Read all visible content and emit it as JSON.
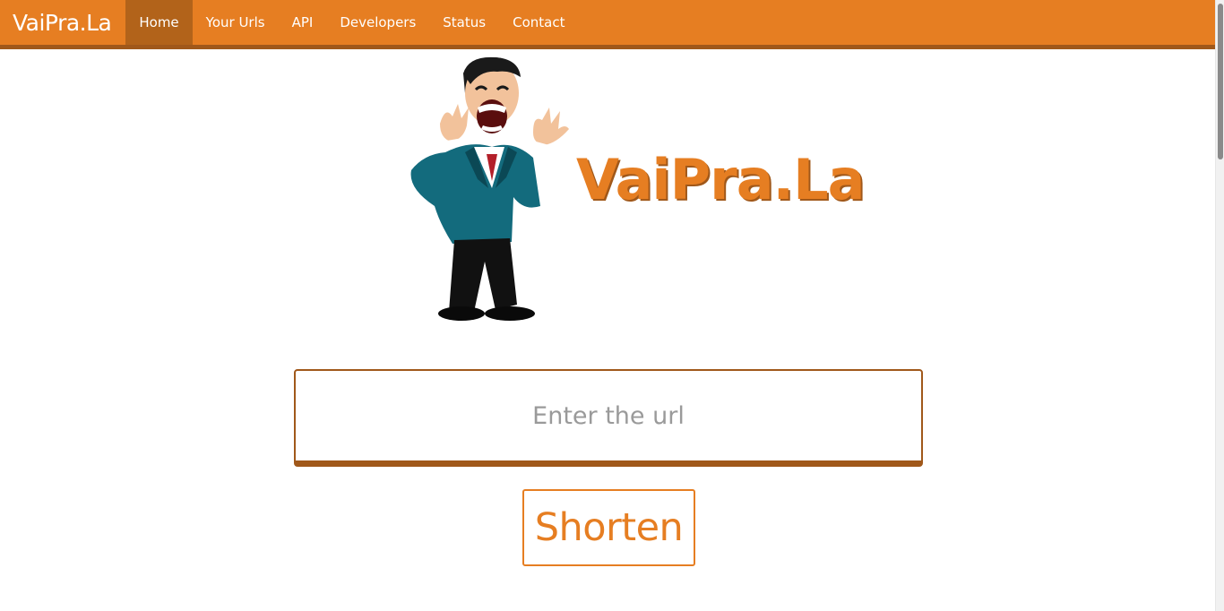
{
  "navbar": {
    "brand": "VaiPra.La",
    "items": [
      {
        "label": "Home",
        "active": true
      },
      {
        "label": "Your Urls",
        "active": false
      },
      {
        "label": "API",
        "active": false
      },
      {
        "label": "Developers",
        "active": false
      },
      {
        "label": "Status",
        "active": false
      },
      {
        "label": "Contact",
        "active": false
      }
    ]
  },
  "hero": {
    "title": "VaiPra.La",
    "mascot_icon": "laughing-man-mascot"
  },
  "form": {
    "url_placeholder": "Enter the url",
    "url_value": "",
    "submit_label": "Shorten"
  },
  "colors": {
    "accent": "#e67e22",
    "accent_dark": "#a0581a",
    "active_nav": "#b2631a"
  }
}
